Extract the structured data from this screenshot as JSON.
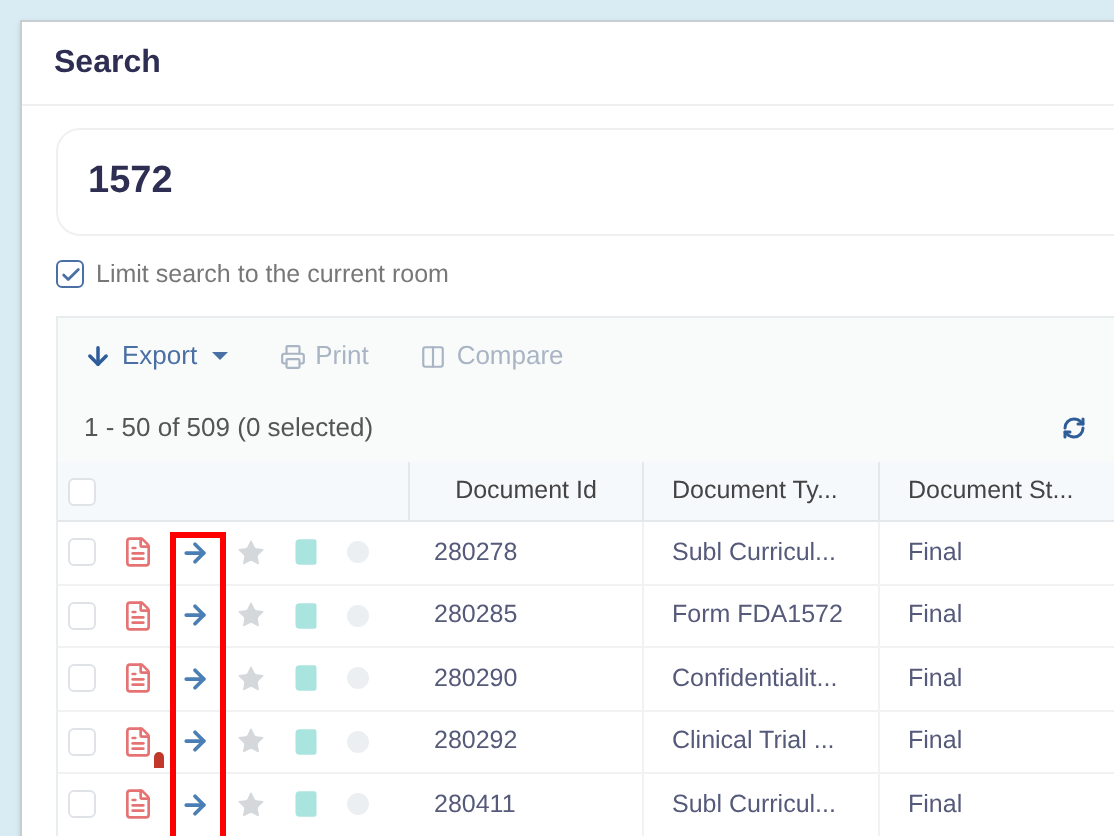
{
  "dialog": {
    "title": "Search"
  },
  "search": {
    "value": "1572"
  },
  "limit_option": {
    "label": "Limit search to the current room",
    "checked": true
  },
  "toolbar": [
    {
      "label": "Export",
      "kind": "dropdown",
      "disabled": false
    },
    {
      "label": "Print",
      "kind": "print",
      "disabled": true
    },
    {
      "label": "Compare",
      "kind": "compare",
      "disabled": true
    }
  ],
  "result_count": "1 - 50 of 509 (0 selected)",
  "table": {
    "select_all_checked": false,
    "columns": [
      "Document Id",
      "Document Ty...",
      "Document St..."
    ],
    "rows": [
      {
        "checked": false,
        "flagged": false,
        "cells": [
          "280278",
          "Subl Curricul...",
          "Final"
        ]
      },
      {
        "checked": false,
        "flagged": false,
        "cells": [
          "280285",
          "Form FDA1572",
          "Final"
        ]
      },
      {
        "checked": false,
        "flagged": false,
        "cells": [
          "280290",
          "Confidentialit...",
          "Final"
        ]
      },
      {
        "checked": false,
        "flagged": true,
        "cells": [
          "280292",
          "Clinical Trial ...",
          "Final"
        ]
      },
      {
        "checked": false,
        "flagged": false,
        "cells": [
          "280411",
          "Subl Curricul...",
          "Final"
        ]
      }
    ]
  }
}
